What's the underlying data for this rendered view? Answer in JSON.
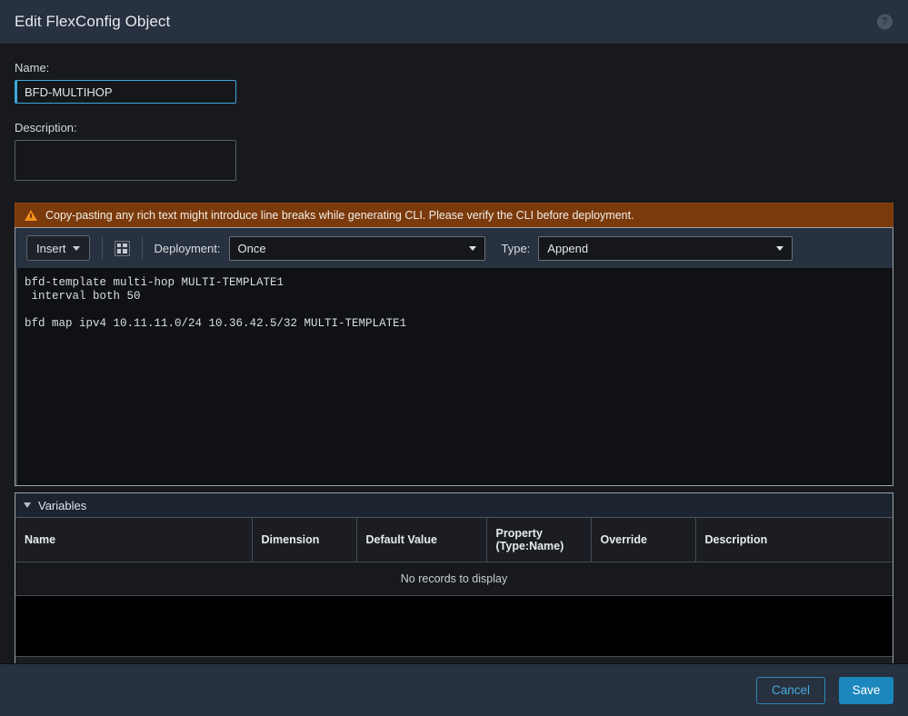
{
  "header": {
    "title": "Edit FlexConfig Object",
    "help_icon": "help-circle-icon",
    "help_label": "?"
  },
  "form": {
    "name_label": "Name:",
    "name_value": "BFD-MULTIHOP",
    "name_placeholder": "",
    "description_label": "Description:",
    "description_value": "",
    "description_placeholder": ""
  },
  "warning": {
    "icon": "warning-triangle-icon",
    "text": "Copy-pasting any rich text might introduce line breaks while generating CLI. Please verify the CLI before deployment."
  },
  "toolbar": {
    "insert_label": "Insert",
    "insert_caret": "▾",
    "grid_icon": "insert-table-icon",
    "deployment_label": "Deployment:",
    "deployment_value": "Once",
    "type_label": "Type:",
    "type_value": "Append",
    "caret": "▾"
  },
  "editor": {
    "content": "bfd-template multi-hop MULTI-TEMPLATE1\n interval both 50\n\nbfd map ipv4 10.11.11.0/24 10.36.42.5/32 MULTI-TEMPLATE1"
  },
  "variables": {
    "section_title": "Variables",
    "collapse_icon": "triangle-down-icon",
    "columns": [
      "Name",
      "Dimension",
      "Default Value",
      "Property\n(Type:Name)",
      "Override",
      "Description"
    ],
    "column_property_line1": "Property",
    "column_property_line2": "(Type:Name)",
    "empty_message": "No records to display",
    "rows": []
  },
  "footer": {
    "cancel_label": "Cancel",
    "save_label": "Save"
  },
  "colors": {
    "header_bg": "#27313f",
    "body_bg": "#17191d",
    "accent_blue": "#1b87bd",
    "focus_border": "#3da8d8",
    "warning_bg": "#7b3a0c",
    "warning_icon": "#f0901e",
    "link_blue": "#4aa8d8"
  }
}
